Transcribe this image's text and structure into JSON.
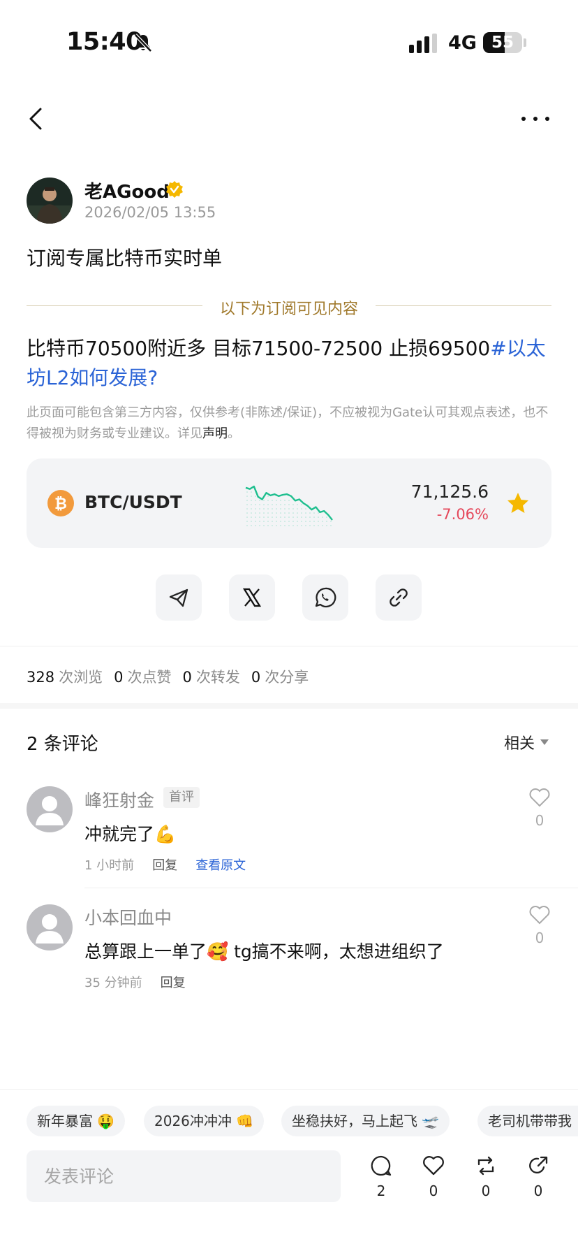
{
  "status_bar": {
    "time": "15:40",
    "network": "4G",
    "battery": "55",
    "battery_level": 0.55
  },
  "author": {
    "name": "老AGood",
    "time": "2026/02/05 13:55"
  },
  "post": {
    "title": "订阅专属比特币实时单",
    "subscription_divider": "以下为订阅可见内容",
    "body": "比特币70500附近多 目标71500-72500 止损69500",
    "hashtag": "#以太坊L2如何发展?",
    "disclaimer": "此页面可能包含第三方内容，仅供参考(非陈述/保证)，不应被视为Gate认可其观点表述，也不得被视为财务或专业建议。详见",
    "disclaimer_link": "声明",
    "disclaimer_end": "。"
  },
  "ticker": {
    "pair": "BTC/USDT",
    "price": "71,125.6",
    "change": "-7.06%",
    "sparkline": [
      60,
      58,
      62,
      46,
      42,
      52,
      48,
      50,
      47,
      49,
      50,
      47,
      40,
      42,
      36,
      32,
      26,
      30,
      22,
      24,
      18,
      10
    ]
  },
  "share": {
    "icons": [
      "telegram-icon",
      "x-icon",
      "whatsapp-icon",
      "link-icon"
    ]
  },
  "stats": {
    "views": "328",
    "views_label": "次浏览",
    "likes": "0",
    "likes_label": "次点赞",
    "reposts": "0",
    "reposts_label": "次转发",
    "shares": "0",
    "shares_label": "次分享"
  },
  "comments": {
    "heading": "2 条评论",
    "sort": "相关",
    "items": [
      {
        "author": "峰狂射金",
        "badge": "首评",
        "text": "冲就完了💪",
        "time": "1 小时前",
        "reply": "回复",
        "view_original": "查看原文",
        "likes": "0"
      },
      {
        "author": "小本回血中",
        "text": "总算跟上一单了🥰 tg搞不来啊，太想进组织了",
        "time": "35 分钟前",
        "reply": "回复",
        "likes": "0"
      }
    ]
  },
  "quick_replies": [
    "新年暴富 🤑",
    "2026冲冲冲 👊",
    "坐稳扶好，马上起飞 🛫",
    "老司机带带我"
  ],
  "bottom_bar": {
    "placeholder": "发表评论",
    "comments": "2",
    "likes": "0",
    "reposts": "0",
    "shares": "0"
  },
  "colors": {
    "accent_link": "#2a63d6",
    "price_down": "#e5475a",
    "sparkline": "#1fbf8f",
    "subscription_gold": "#a0792b",
    "star": "#f5b800"
  }
}
